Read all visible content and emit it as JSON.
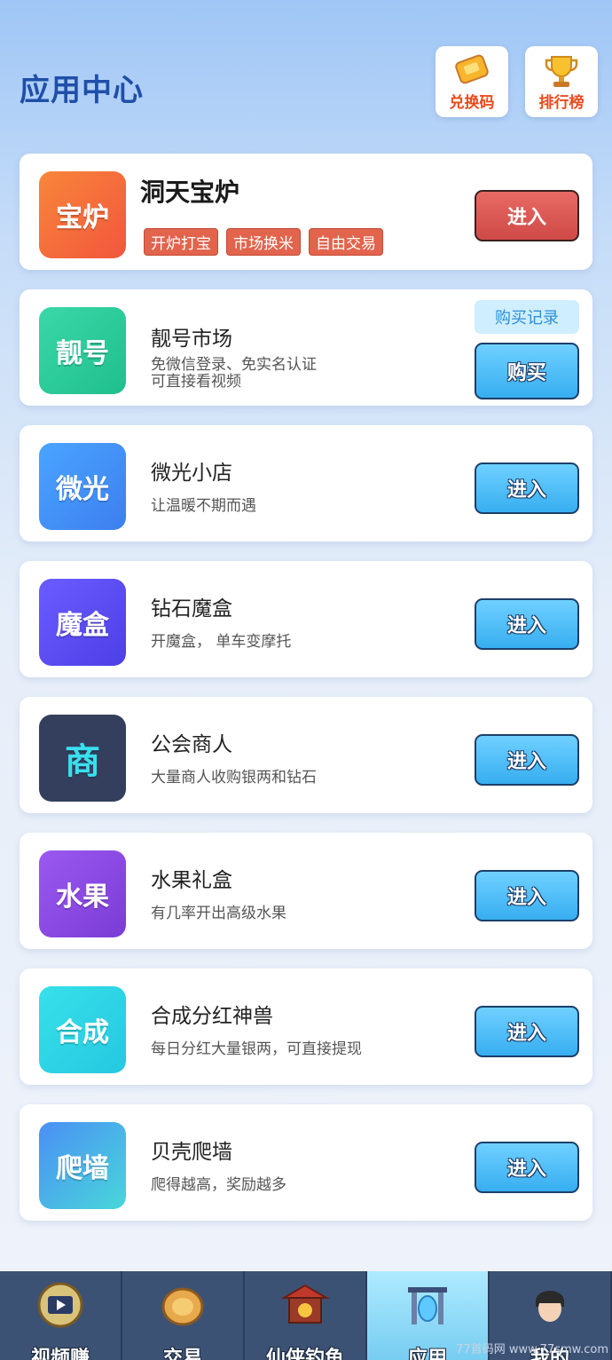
{
  "header": {
    "title": "应用中心",
    "redeem_label": "兑换码",
    "rank_label": "排行榜"
  },
  "featured": {
    "tile": "宝炉",
    "name": "洞天宝炉",
    "tags": [
      "开炉打宝",
      "市场换米",
      "自由交易"
    ],
    "button": "进入"
  },
  "lianghao": {
    "tile": "靓号",
    "name": "靓号市场",
    "desc_line1": "免微信登录、免实名认证",
    "desc_line2": "可直接看视频",
    "record": "购买记录",
    "button": "购买"
  },
  "apps": [
    {
      "tile": "微光",
      "name": "微光小店",
      "desc": "让温暖不期而遇",
      "button": "进入",
      "color": "#3f8ef5"
    },
    {
      "tile": "魔盒",
      "name": "钻石魔盒",
      "desc": "开魔盒， 单车变摩托",
      "button": "进入",
      "color": "#5a4ff0"
    },
    {
      "tile": "商",
      "name": "公会商人",
      "desc": "大量商人收购银两和钻石",
      "button": "进入",
      "color": "#333f5e"
    },
    {
      "tile": "水果",
      "name": "水果礼盒",
      "desc": "有几率开出高级水果",
      "button": "进入",
      "color": "#8a49e0"
    },
    {
      "tile": "合成",
      "name": "合成分红神兽",
      "desc": "每日分红大量银两，可直接提现",
      "button": "进入",
      "color": "#2ed7e8"
    },
    {
      "tile": "爬墙",
      "name": "贝壳爬墙",
      "desc": "爬得越高，奖励越多",
      "button": "进入",
      "color": "#46a6ee"
    }
  ],
  "tabbar": [
    {
      "label": "视频赚",
      "icon": "film-icon"
    },
    {
      "label": "交易",
      "icon": "gold-coin-icon"
    },
    {
      "label": "仙侠钓鱼",
      "icon": "temple-icon"
    },
    {
      "label": "应用",
      "icon": "portal-gate-icon"
    },
    {
      "label": "我的",
      "icon": "avatar-icon"
    }
  ],
  "watermark": "77首码网 www.77smw.com"
}
